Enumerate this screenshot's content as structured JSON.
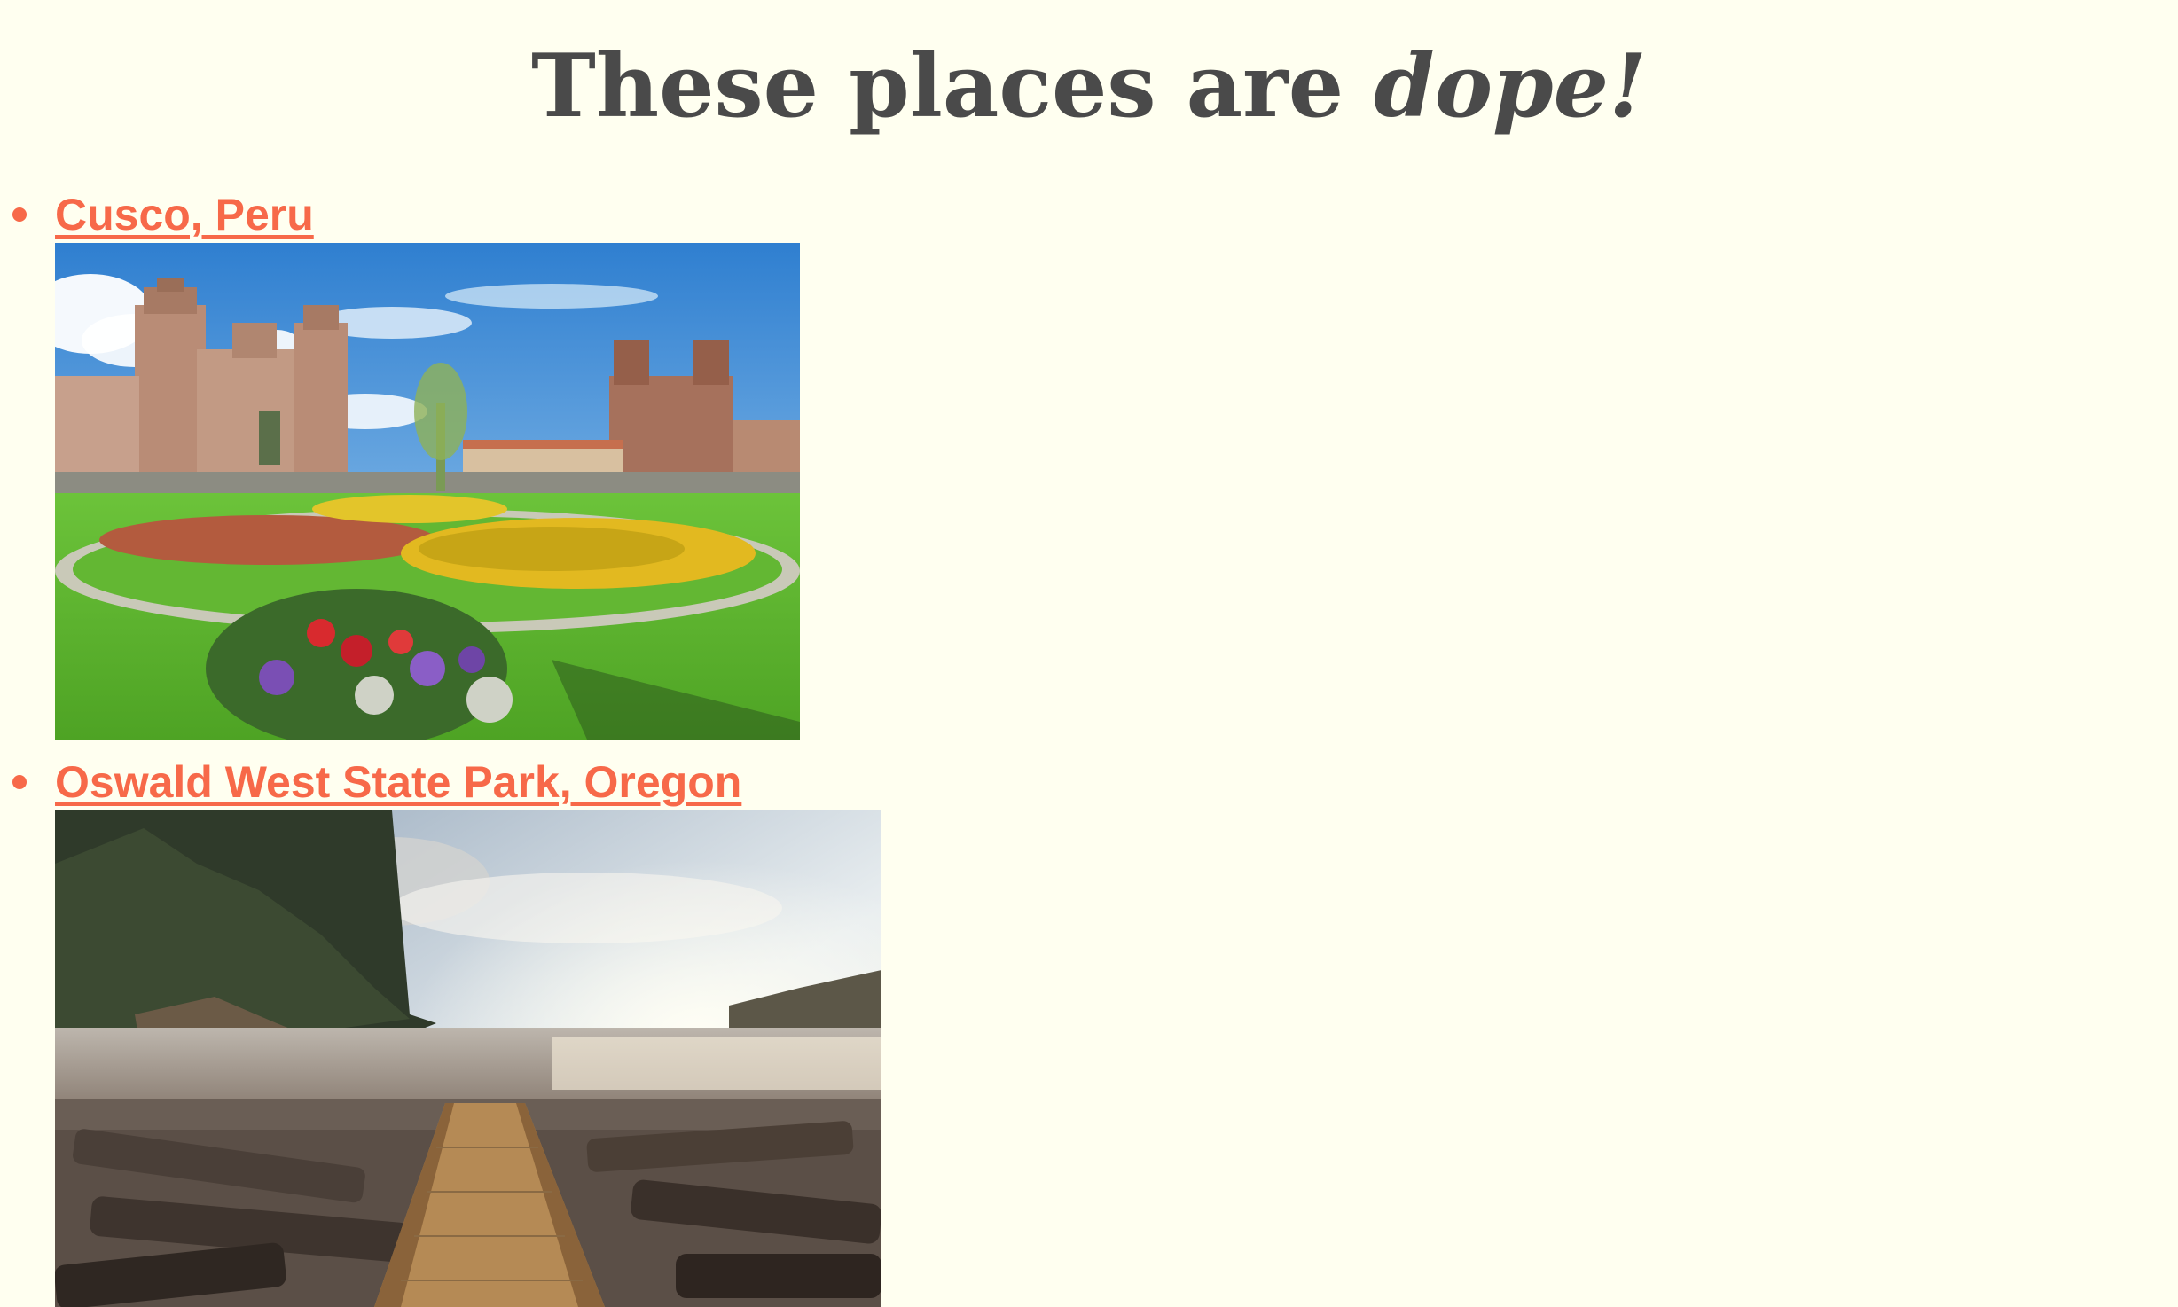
{
  "page": {
    "title_prefix": "These places are ",
    "title_emphasis": "dope!"
  },
  "places": [
    {
      "name": "Cusco, Peru"
    },
    {
      "name": "Oswald West State Park, Oregon"
    }
  ],
  "colors": {
    "background": "#fffff0",
    "accent": "#f76949",
    "title": "#4a4a4a"
  }
}
